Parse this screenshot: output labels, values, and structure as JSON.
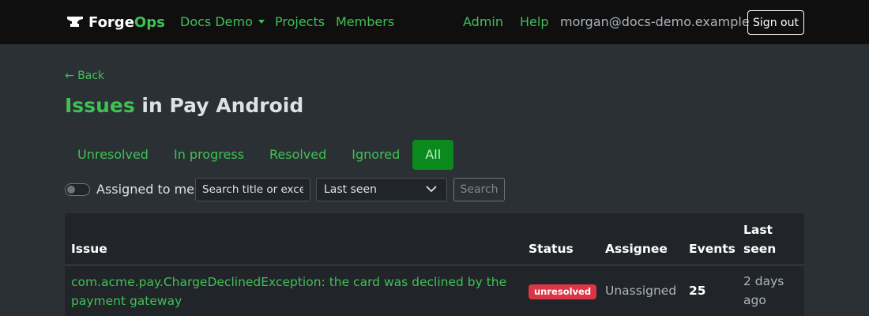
{
  "nav": {
    "brand_part1": "Forge",
    "brand_part2": "Ops",
    "org_dropdown": "Docs Demo",
    "projects": "Projects",
    "members": "Members",
    "admin": "Admin",
    "help": "Help",
    "user_email": "morgan@docs-demo.example",
    "sign_out": "Sign out"
  },
  "back": "← Back",
  "title": {
    "highlight": "Issues",
    "rest": " in Pay Android"
  },
  "tabs": [
    "Unresolved",
    "In progress",
    "Resolved",
    "Ignored",
    "All"
  ],
  "active_tab": "All",
  "filters": {
    "assigned_label": "Assigned to me",
    "assigned_on": false,
    "search_placeholder": "Search title or exce",
    "sort_value": "Last seen",
    "search_button": "Search"
  },
  "table": {
    "headers": {
      "issue": "Issue",
      "status": "Status",
      "assignee": "Assignee",
      "events": "Events",
      "last_seen_1": "Last",
      "last_seen_2": "seen"
    },
    "rows": [
      {
        "issue": "com.acme.pay.ChargeDeclinedException: the card was declined by the payment gateway",
        "status": "unresolved",
        "assignee": "Unassigned",
        "events": "25",
        "last_seen_1": "2 days",
        "last_seen_2": "ago"
      }
    ]
  },
  "colors": {
    "accent": "#3fc154",
    "active_tab_bg": "#0a8a1c",
    "navbar_bg": "#0f0f0f",
    "page_bg": "#2b3035",
    "table_bg": "#212529",
    "badge_unresolved": "#dc3545"
  },
  "icons": {
    "brand": "anvil-icon",
    "org_caret": "caret-down-icon",
    "select_arrow": "chevron-down-icon"
  }
}
